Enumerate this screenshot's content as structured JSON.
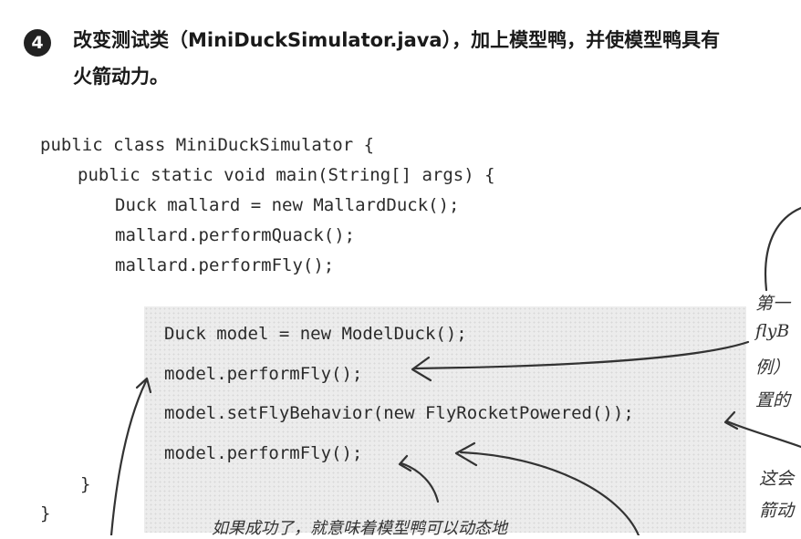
{
  "step": {
    "number": "4",
    "line1": "改变测试类（MiniDuckSimulator.java），加上模型鸭，并使模型鸭具有",
    "line2": "火箭动力。"
  },
  "code": {
    "lines": [
      "public class MiniDuckSimulator {",
      "public static void main(String[] args) {",
      "Duck mallard = new MallardDuck();",
      "mallard.performQuack();",
      "mallard.performFly();",
      "Duck model = new ModelDuck();",
      "model.performFly();",
      "model.setFlyBehavior(new FlyRocketPowered());",
      "model.performFly();",
      "}",
      "}"
    ]
  },
  "annotations": {
    "right_top": [
      "第一",
      "flyB",
      "例）",
      "置的"
    ],
    "right_bottom": [
      "这会",
      "箭动"
    ],
    "bottom": "如果成功了，就意味着模型鸭可以动态地"
  }
}
